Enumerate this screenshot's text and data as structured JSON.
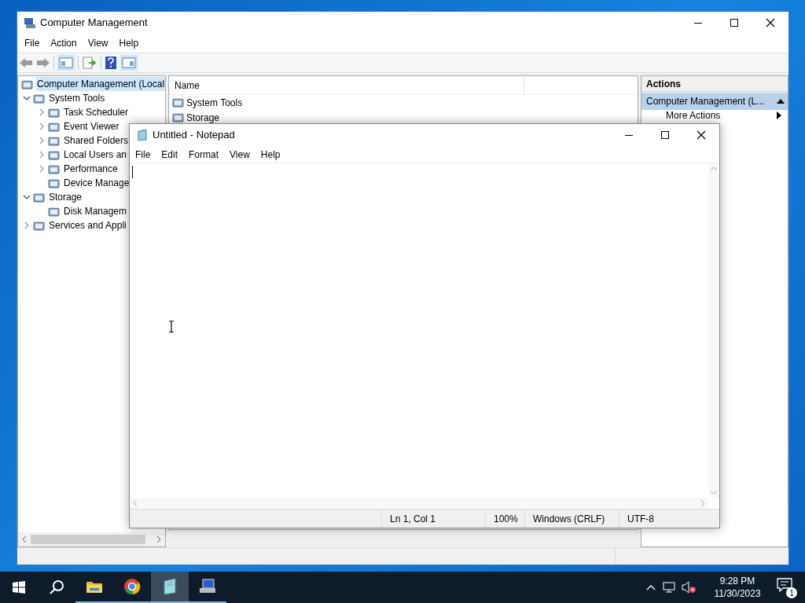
{
  "computer_management": {
    "title": "Computer Management",
    "menu": [
      "File",
      "Action",
      "View",
      "Help"
    ],
    "tree": [
      {
        "label": "Computer Management (Local",
        "selected": true,
        "children": [
          {
            "label": "System Tools",
            "expanded": true,
            "children": [
              {
                "label": "Task Scheduler",
                "expanded": false
              },
              {
                "label": "Event Viewer",
                "expanded": false
              },
              {
                "label": "Shared Folders",
                "expanded": false
              },
              {
                "label": "Local Users an",
                "expanded": false
              },
              {
                "label": "Performance",
                "expanded": false
              },
              {
                "label": "Device Manage"
              }
            ]
          },
          {
            "label": "Storage",
            "expanded": true,
            "children": [
              {
                "label": "Disk Managem"
              }
            ]
          },
          {
            "label": "Services and Appli",
            "expanded": false
          }
        ]
      }
    ],
    "list": {
      "columns": [
        "Name"
      ],
      "rows": [
        "System Tools",
        "Storage"
      ]
    },
    "actions": {
      "title": "Actions",
      "group": "Computer Management (L...",
      "items": [
        "More Actions"
      ]
    }
  },
  "notepad": {
    "title": "Untitled - Notepad",
    "menu": [
      "File",
      "Edit",
      "Format",
      "View",
      "Help"
    ],
    "status_bar": [
      "Ln 1, Col 1",
      "100%",
      "Windows (CRLF)",
      "UTF-8"
    ]
  },
  "taskbar": {
    "apps": [
      {
        "kind": "explorer",
        "selected": false
      },
      {
        "kind": "chrome",
        "selected": false
      },
      {
        "kind": "notepad",
        "selected": true
      },
      {
        "kind": "compmgmt",
        "selected": false
      }
    ],
    "time": "9:28 PM",
    "date": "11/30/2023",
    "notifications": "1"
  }
}
